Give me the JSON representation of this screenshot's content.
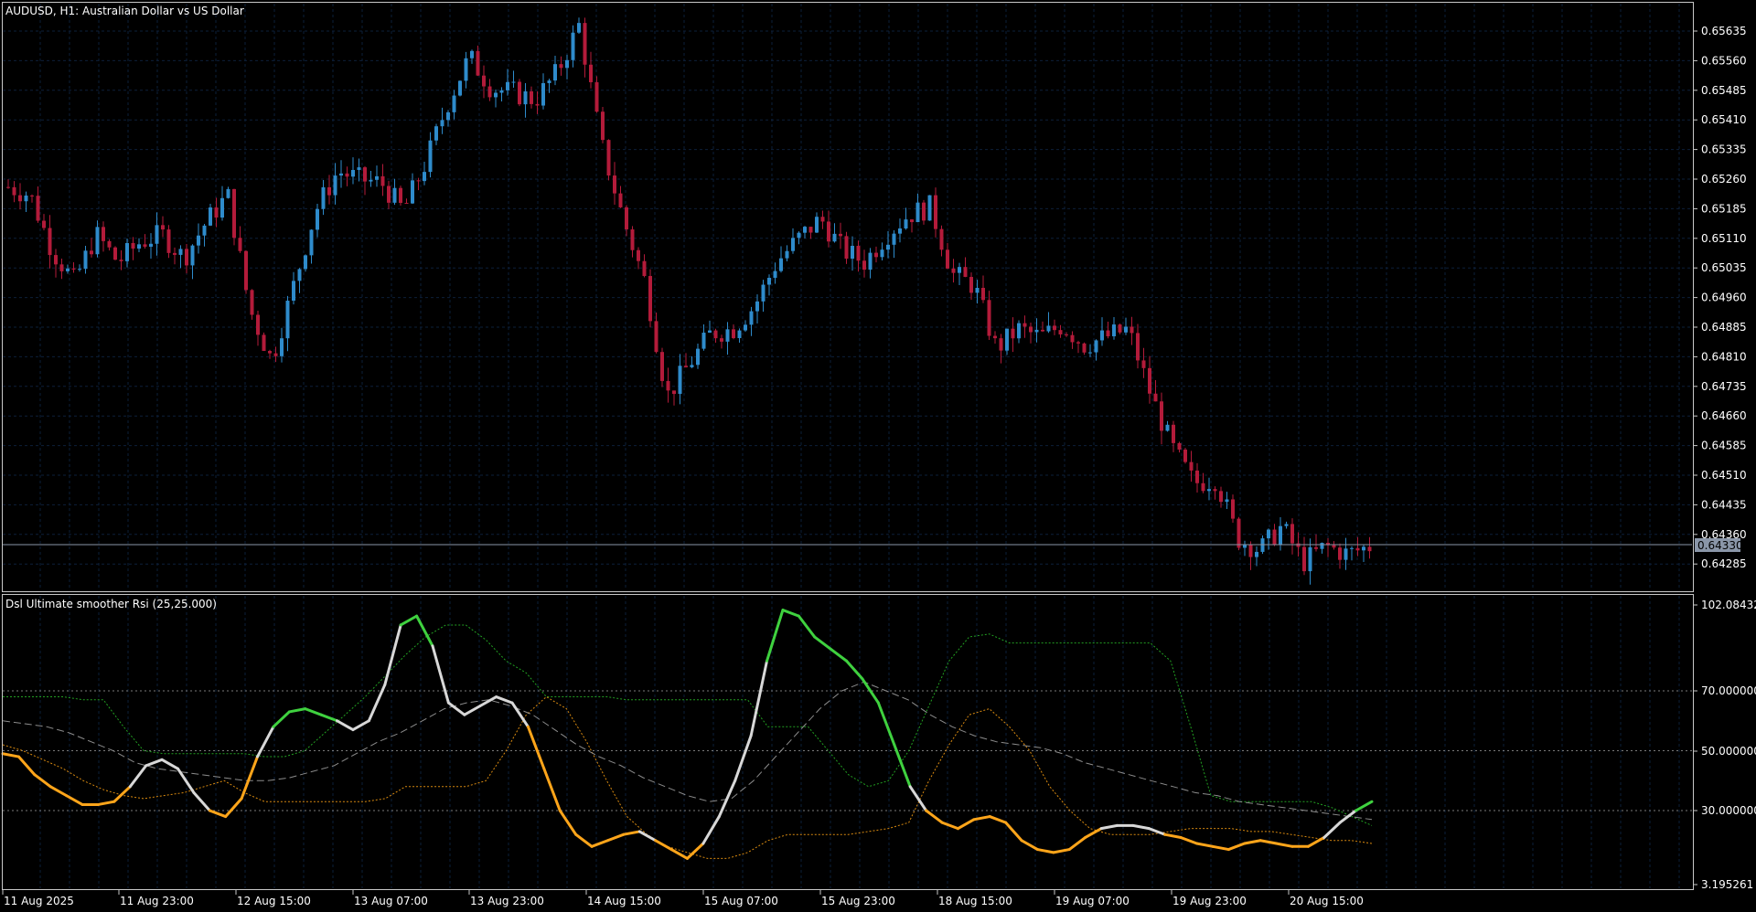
{
  "main_title": "AUDUSD, H1:  Australian Dollar vs US Dollar",
  "indicator_title": "Dsl Ultimate smoother Rsi (25,25.000)",
  "current_price_label": "0.64330",
  "colors": {
    "background": "#000000",
    "frame": "#c8c8c8",
    "grid": "#0d1f3a",
    "bull": "#2e8bcb",
    "bear": "#b31b3a",
    "price_line": "#8a96a8",
    "rsi_up": "#3fd13f",
    "rsi_down": "#ffa51a",
    "rsi_neutral": "#d8d8d8",
    "band_up": "#22a022",
    "band_down": "#d98a10",
    "signal": "#8c8c8c"
  },
  "price_axis": {
    "ticks": [
      "0.65635",
      "0.65560",
      "0.65485",
      "0.65410",
      "0.65335",
      "0.65260",
      "0.65185",
      "0.65110",
      "0.65035",
      "0.64960",
      "0.64885",
      "0.64810",
      "0.64735",
      "0.64660",
      "0.64585",
      "0.64510",
      "0.64435",
      "0.64360",
      "0.64285"
    ],
    "min": 0.6423,
    "max": 0.6568
  },
  "indicator_axis": {
    "ticks": [
      "102.084323",
      "70.000000",
      "50.000000",
      "30.000000",
      "3.195261"
    ],
    "levels": [
      70,
      50,
      30
    ]
  },
  "time_axis": [
    "11 Aug 2025",
    "11 Aug 23:00",
    "12 Aug 15:00",
    "13 Aug 07:00",
    "13 Aug 23:00",
    "14 Aug 15:00",
    "15 Aug 07:00",
    "15 Aug 23:00",
    "18 Aug 15:00",
    "19 Aug 07:00",
    "19 Aug 23:00",
    "20 Aug 15:00"
  ],
  "chart_data": {
    "type": "candlestick",
    "instrument": "AUDUSD",
    "timeframe": "H1",
    "close_path": [
      0.6524,
      0.6522,
      0.6508,
      0.65,
      0.6512,
      0.6505,
      0.651,
      0.6512,
      0.6506,
      0.6515,
      0.6522,
      0.6493,
      0.648,
      0.6499,
      0.6518,
      0.6528,
      0.6526,
      0.6525,
      0.6518,
      0.653,
      0.6545,
      0.6557,
      0.6549,
      0.6548,
      0.6546,
      0.6553,
      0.6565,
      0.6535,
      0.6516,
      0.65,
      0.6471,
      0.6479,
      0.6487,
      0.6488,
      0.6494,
      0.6505,
      0.6511,
      0.6516,
      0.6508,
      0.6505,
      0.6512,
      0.6517,
      0.6519,
      0.6502,
      0.6499,
      0.6483,
      0.6488,
      0.6486,
      0.6489,
      0.6484,
      0.6486,
      0.6488,
      0.6472,
      0.6458,
      0.6449,
      0.645,
      0.6435,
      0.6432,
      0.6438,
      0.6429,
      0.6433,
      0.6431,
      0.6433
    ],
    "rsi": [
      49,
      48,
      42,
      38,
      35,
      32,
      32,
      33,
      38,
      45,
      47,
      44,
      36,
      30,
      28,
      34,
      48,
      58,
      63,
      64,
      62,
      60,
      57,
      60,
      72,
      92,
      95,
      85,
      66,
      62,
      65,
      68,
      66,
      58,
      44,
      30,
      22,
      18,
      20,
      22,
      23,
      20,
      17,
      14,
      19,
      28,
      40,
      55,
      80,
      97,
      95,
      88,
      84,
      80,
      74,
      66,
      52,
      38,
      30,
      26,
      24,
      27,
      28,
      26,
      20,
      17,
      16,
      17,
      21,
      24,
      25,
      25,
      24,
      22,
      21,
      19,
      18,
      17,
      19,
      20,
      19,
      18,
      18,
      21,
      26,
      30,
      33
    ],
    "band_up": [
      68,
      68,
      68,
      68,
      67,
      67,
      58,
      50,
      49,
      49,
      49,
      49,
      49,
      48,
      48,
      50,
      56,
      62,
      68,
      75,
      82,
      88,
      92,
      92,
      87,
      80,
      76,
      68,
      68,
      68,
      68,
      67,
      67,
      67,
      67,
      67,
      67,
      67,
      58,
      58,
      58,
      50,
      42,
      38,
      40,
      50,
      65,
      80,
      88,
      89,
      86,
      86,
      86,
      86,
      86,
      86,
      86,
      86,
      80,
      58,
      35,
      33,
      33,
      33,
      33,
      33,
      31,
      28,
      25
    ],
    "band_down": [
      52,
      50,
      47,
      44,
      40,
      37,
      35,
      34,
      35,
      36,
      38,
      40,
      36,
      33,
      33,
      33,
      33,
      33,
      33,
      34,
      38,
      38,
      38,
      38,
      40,
      50,
      62,
      68,
      64,
      53,
      40,
      28,
      22,
      18,
      16,
      14,
      14,
      16,
      20,
      22,
      22,
      22,
      22,
      23,
      24,
      26,
      40,
      52,
      62,
      64,
      58,
      50,
      38,
      30,
      24,
      22,
      22,
      22,
      23,
      24,
      24,
      24,
      23,
      23,
      22,
      21,
      20,
      20,
      19
    ],
    "signal": [
      60,
      59,
      58,
      56,
      53,
      50,
      46,
      44,
      43,
      42,
      41,
      40,
      40,
      41,
      43,
      45,
      49,
      53,
      56,
      60,
      64,
      66,
      67,
      65,
      62,
      57,
      52,
      48,
      45,
      41,
      38,
      35,
      33,
      34,
      40,
      48,
      56,
      64,
      70,
      73,
      70,
      67,
      62,
      58,
      55,
      53,
      52,
      51,
      49,
      46,
      44,
      42,
      40,
      38,
      36,
      35,
      33,
      32,
      31,
      30,
      29,
      28,
      27
    ]
  }
}
